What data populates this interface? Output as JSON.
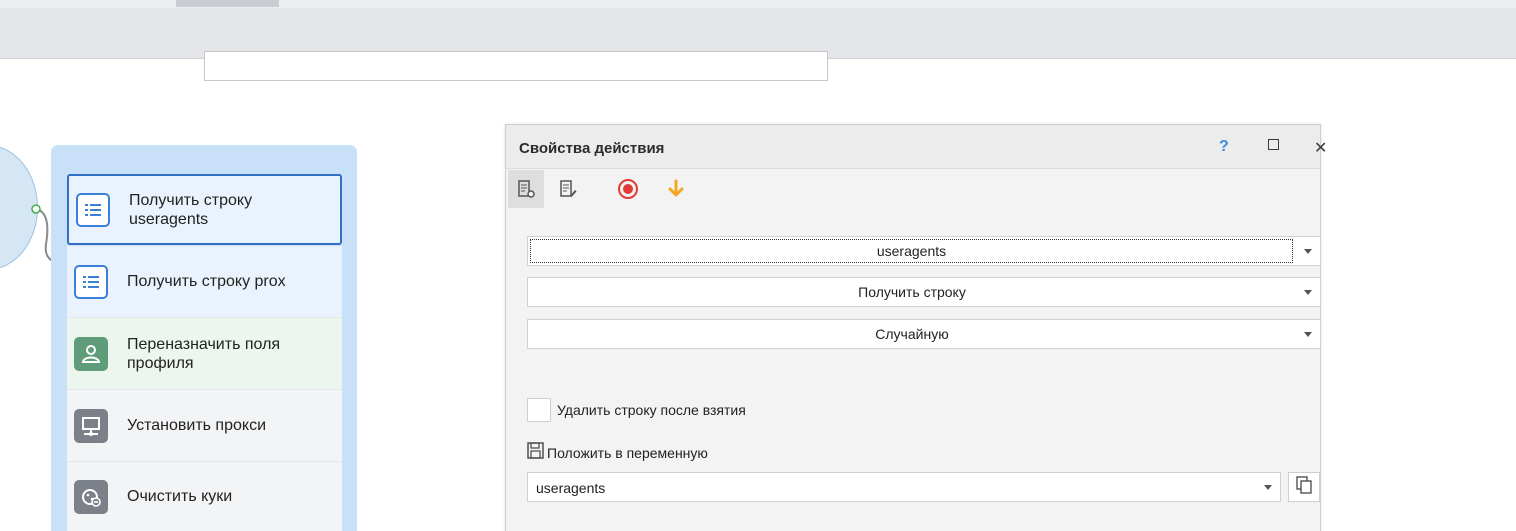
{
  "canvas": {
    "actions": [
      {
        "label_line1": "Получить строку",
        "label_line2": "useragents",
        "icon": "list-icon"
      },
      {
        "label_line1": "Получить строку prox",
        "label_line2": "",
        "icon": "list-icon"
      },
      {
        "label_line1": "Переназначить поля",
        "label_line2": "профиля",
        "icon": "user-icon"
      },
      {
        "label_line1": "Установить прокси",
        "label_line2": "",
        "icon": "monitor-network-icon"
      },
      {
        "label_line1": "Очистить куки",
        "label_line2": "",
        "icon": "cookie-icon"
      }
    ]
  },
  "panel": {
    "title": "Свойства действия",
    "help": "?",
    "close": "✕",
    "search_value": "",
    "list_name": "useragents",
    "operation": "Получить строку",
    "line_mode": "Случайную",
    "delete_after_label": "Удалить строку после взятия",
    "delete_after_checked": false,
    "save_to_var_label": "Положить в переменную",
    "variable_value": "useragents"
  },
  "colors": {
    "accent_blue": "#2f6fc4",
    "group_bg": "#c9e0f9",
    "record_red": "#e53935",
    "arrow_orange": "#f5a623",
    "help_blue": "#3d8be5"
  }
}
